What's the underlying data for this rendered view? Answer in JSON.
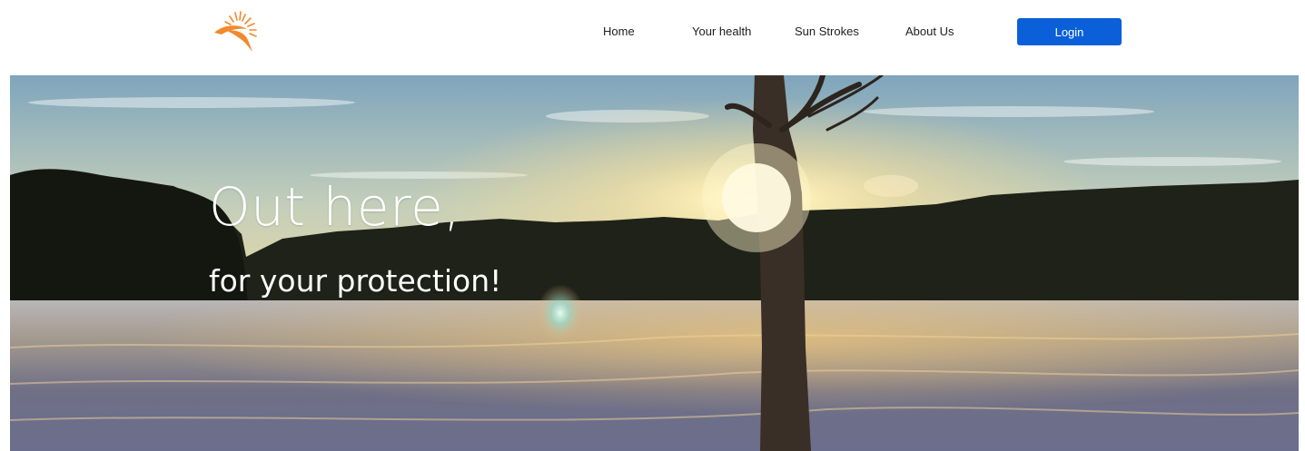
{
  "header": {
    "logo_icon": "sun-logo-icon",
    "nav": [
      {
        "label": "Home"
      },
      {
        "label": "Your health"
      },
      {
        "label": "Sun Strokes"
      },
      {
        "label": "About Us"
      }
    ],
    "login_label": "Login"
  },
  "hero": {
    "title": "Out here,",
    "subtitle": "for your protection!",
    "background": "snowy-field-sunset-tree-photo"
  },
  "colors": {
    "accent": "#0b5fd8",
    "logo": "#f08a2c",
    "text": "#1d1d1d",
    "hero_text": "#ffffff"
  }
}
